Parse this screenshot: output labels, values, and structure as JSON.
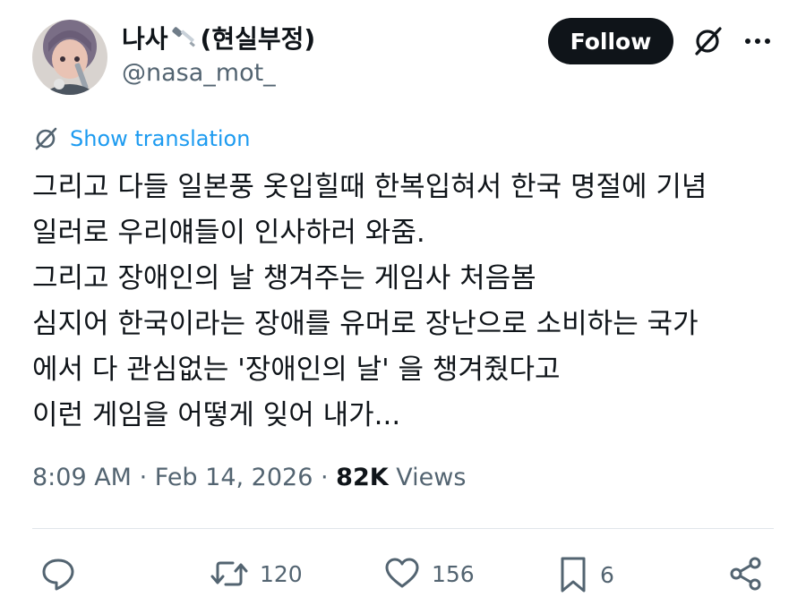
{
  "author": {
    "display_name": "나사",
    "display_name_suffix": "(현실부정)",
    "name_emoji_icon": "screwdriver-icon",
    "handle": "@nasa_mot_",
    "avatar_icon": "avatar-image"
  },
  "header": {
    "follow_label": "Follow",
    "grok_icon": "grok-icon",
    "more_icon": "more-dots-icon"
  },
  "translation": {
    "label": "Show translation",
    "icon": "translate-globe-icon",
    "color": "#1d9bf0"
  },
  "tweet": {
    "lines": [
      "그리고 다들 일본풍 옷입힐때 한복입혀서 한국 명절에 기념",
      "일러로 우리얘들이 인사하러 와줌.",
      "그리고 장애인의 날 챙겨주는 게임사 처음봄",
      "심지어 한국이라는 장애를 유머로 장난으로 소비하는 국가",
      "에서 다 관심없는 '장애인의 날' 을 챙겨줬다고",
      "이런 게임을 어떻게 잊어 내가..."
    ]
  },
  "meta": {
    "time": "8:09 AM",
    "separator": "·",
    "date": "Feb 14, 2026",
    "views_count": "82K",
    "views_label": "Views"
  },
  "actions": {
    "reply": {
      "icon": "reply-icon",
      "count": ""
    },
    "retweet": {
      "icon": "retweet-icon",
      "count": "120"
    },
    "like": {
      "icon": "heart-icon",
      "count": "156"
    },
    "bookmark": {
      "icon": "bookmark-icon",
      "count": "6"
    },
    "share": {
      "icon": "share-icon",
      "count": ""
    }
  },
  "colors": {
    "text_primary": "#0f1419",
    "text_secondary": "#536471",
    "follow_button_bg": "#0f1419",
    "link": "#1d9bf0"
  }
}
